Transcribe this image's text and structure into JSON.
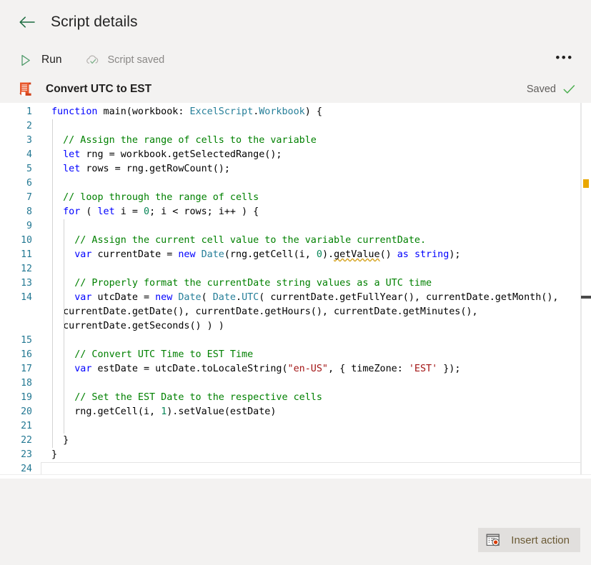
{
  "header": {
    "back_icon": "arrow-left-icon",
    "title": "Script details"
  },
  "toolbar": {
    "run_icon": "play-triangle-icon",
    "run_label": "Run",
    "cloud_icon": "cloud-check-icon",
    "save_status": "Script saved",
    "more_icon": "ellipsis-icon",
    "more_label": "•••"
  },
  "script": {
    "icon": "script-document-icon",
    "name": "Convert UTC to EST",
    "saved_label": "Saved",
    "check_icon": "checkmark-icon"
  },
  "footer": {
    "insert_action_icon": "record-action-icon",
    "insert_action_label": "Insert action"
  },
  "colors": {
    "accent_green": "#1b6b3f",
    "script_icon": "#d83b01",
    "warning_marker": "#e9a700",
    "keyword": "#0000ff",
    "comment": "#008000",
    "string": "#a31515",
    "type": "#267f99",
    "number": "#098658",
    "linenumber": "#237893",
    "chrome_bg": "#f3f2f1",
    "editor_bg": "#ffffff"
  },
  "editor": {
    "language": "typescript",
    "total_lines": 24,
    "lines": [
      {
        "num": "1",
        "text": "function main(workbook: ExcelScript.Workbook) {"
      },
      {
        "num": "2",
        "text": ""
      },
      {
        "num": "3",
        "text": "  // Assign the range of cells to the variable"
      },
      {
        "num": "4",
        "text": "  let rng = workbook.getSelectedRange();"
      },
      {
        "num": "5",
        "text": "  let rows = rng.getRowCount();"
      },
      {
        "num": "6",
        "text": ""
      },
      {
        "num": "7",
        "text": "  // loop through the range of cells"
      },
      {
        "num": "8",
        "text": "  for ( let i = 0; i < rows; i++ ) {"
      },
      {
        "num": "9",
        "text": ""
      },
      {
        "num": "10",
        "text": "    // Assign the current cell value to the variable currentDate."
      },
      {
        "num": "11",
        "text": "    var currentDate = new Date(rng.getCell(i, 0).getValue() as string);"
      },
      {
        "num": "12",
        "text": ""
      },
      {
        "num": "13",
        "text": "    // Properly format the currentDate string values as a UTC time"
      },
      {
        "num": "14",
        "text": "    var utcDate = new Date( Date.UTC( currentDate.getFullYear(), currentDate.getMonth(), currentDate.getDate(), currentDate.getHours(), currentDate.getMinutes(), currentDate.getSeconds() ) )"
      },
      {
        "num": "15",
        "text": ""
      },
      {
        "num": "16",
        "text": "    // Convert UTC Time to EST Time"
      },
      {
        "num": "17",
        "text": "    var estDate = utcDate.toLocaleString(\"en-US\", { timeZone: 'EST' });"
      },
      {
        "num": "18",
        "text": ""
      },
      {
        "num": "19",
        "text": "    // Set the EST Date to the respective cells"
      },
      {
        "num": "20",
        "text": "    rng.getCell(i, 1).setValue(estDate)"
      },
      {
        "num": "21",
        "text": ""
      },
      {
        "num": "22",
        "text": "  }"
      },
      {
        "num": "23",
        "text": "}"
      },
      {
        "num": "24",
        "text": ""
      }
    ]
  }
}
